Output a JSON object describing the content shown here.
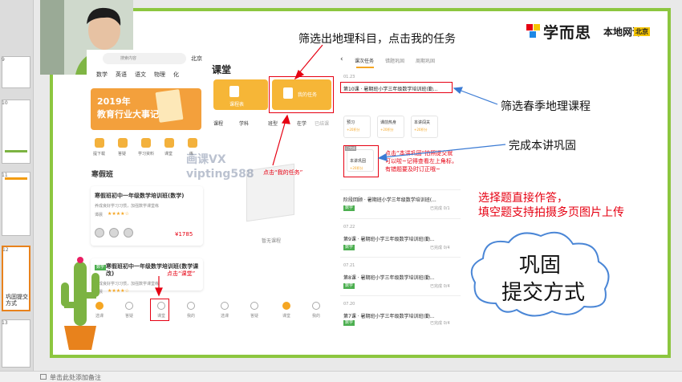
{
  "thumbnails": {
    "numbers": [
      "9",
      "10",
      "11",
      "12",
      "13",
      "14"
    ],
    "slide12_text": "巩固提交方式"
  },
  "status_bar": {
    "notes_hint": "单击此处添加备注"
  },
  "brand": {
    "name": "学而思",
    "sub": "本地网课",
    "city": "北京"
  },
  "annotations": {
    "filter_subject": "筛选出地理科目，点击我的任务",
    "filter_spring": "筛选春季地理课程",
    "complete": "完成本讲巩固",
    "answer_line1": "选择题直接作答，",
    "answer_line2": "填空题支持拍摄多页图片上传",
    "click_my_task": "点击“我的任务”",
    "click_classroom": "点击“课堂”",
    "click_consolidate": "点击“本讲巩固”拍照提交就可以啦~记得查看左上角标，有错题要及时订正哦~",
    "cloud_line1": "巩固",
    "cloud_line2": "提交方式"
  },
  "watermark": {
    "line1": "画课VX",
    "line2": "vipting588"
  },
  "phone1": {
    "search_placeholder": "搜索内容",
    "city": "北京",
    "subjects": [
      "数学",
      "英语",
      "语文",
      "物理",
      "化"
    ],
    "banner_year": "2019年",
    "banner_title": "教育行业大事记",
    "quick": [
      "提下载",
      "答疑",
      "学习资料",
      "课堂",
      "练"
    ],
    "section": "寒假班",
    "course1_title": "寒假班初中一年级数学培训班(数学)",
    "course1_desc": "养成良好学习习惯，加强数学课堂练",
    "course1_teacher": "谭晨",
    "course1_price": "¥1785",
    "course2_tag": "数学",
    "course2_title": "寒假班初中一年级数学培训班(数学课改)",
    "course2_desc": "养成良好学习习惯，加强数学课堂练",
    "course2_teacher": "谭晨",
    "nav": [
      "选课",
      "答疑",
      "课堂",
      "我的"
    ]
  },
  "phone2": {
    "title": "课堂",
    "btn1": "课程表",
    "btn2": "我的任务",
    "filters": [
      "课程",
      "学科",
      "班型",
      "在学",
      "已结课"
    ],
    "empty": "暂无课程",
    "nav": [
      "选课",
      "答疑",
      "课堂",
      "我的"
    ]
  },
  "phone3": {
    "tabs": [
      "课次任务",
      "错题巩固",
      "周期巩固"
    ],
    "date1": "01.23",
    "row1_title": "第10课 · 暑期班小学三年级数学培训班(勤...",
    "cards": [
      {
        "t": "预习",
        "s": "+20积分"
      },
      {
        "t": "课前热身",
        "s": "+20积分"
      },
      {
        "t": "本讲闯关",
        "s": "+20积分"
      },
      {
        "t": "本讲巩固",
        "s": "+20积分"
      }
    ],
    "card_badge": "已完成",
    "row_stage_title": "阶段回顾 · 暑期班小学三年级数学培训班(...",
    "row_stage_meta": "已完成 0/1",
    "rows": [
      {
        "date": "07.22",
        "title": "第9课 · 暑期班小学三年级数学培训班(勤...",
        "meta": "已完成 0/4"
      },
      {
        "date": "07.21",
        "title": "第8课 · 暑期班小学三年级数学培训班(勤...",
        "meta": "已完成 0/4"
      },
      {
        "date": "07.20",
        "title": "第7课 · 暑期班小学三年级数学培训班(勤...",
        "meta": "已完成 0/4"
      }
    ],
    "tag": "数学"
  },
  "colors": {
    "accent_green": "#8cc63f",
    "annotation_red": "#e60012",
    "brand_yellow": "#f5c400",
    "button_orange": "#f6b637"
  }
}
